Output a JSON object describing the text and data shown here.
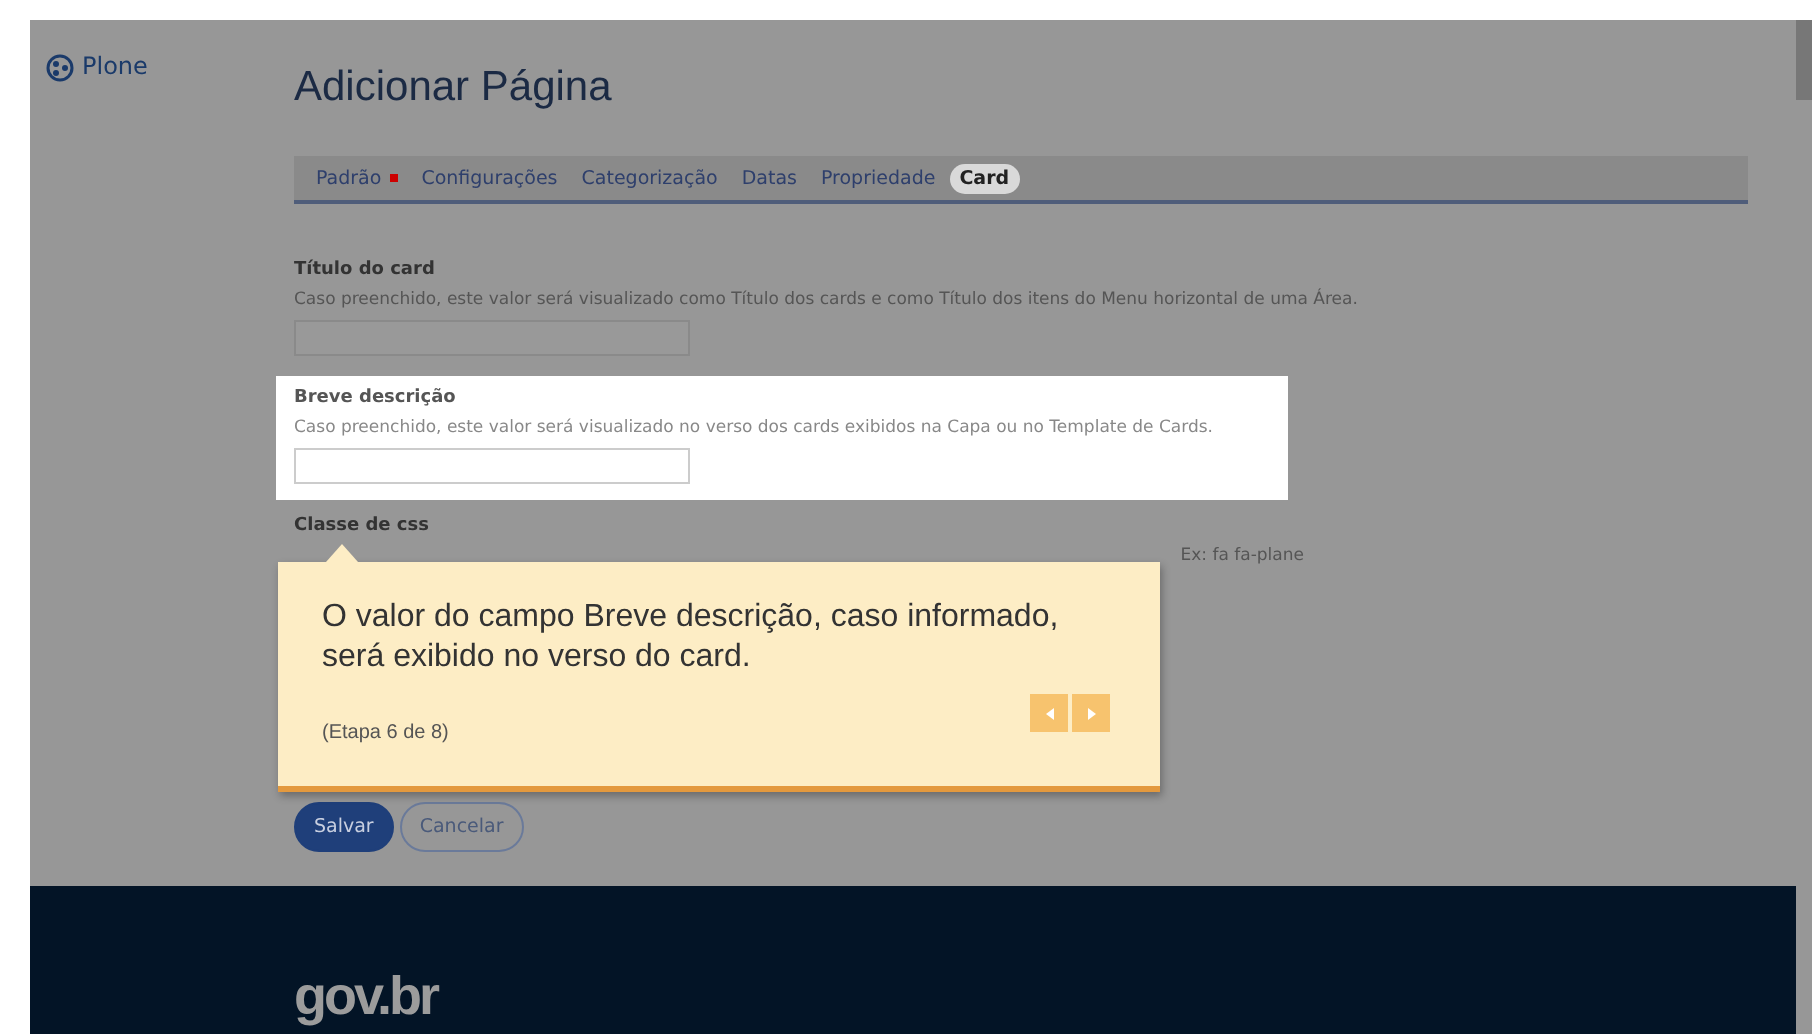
{
  "logo": {
    "text": "Plone"
  },
  "page": {
    "title": "Adicionar Página"
  },
  "tabs": [
    {
      "label": "Padrão",
      "selected": false,
      "required": true
    },
    {
      "label": "Configurações",
      "selected": false,
      "required": false
    },
    {
      "label": "Categorização",
      "selected": false,
      "required": false
    },
    {
      "label": "Datas",
      "selected": false,
      "required": false
    },
    {
      "label": "Propriedade",
      "selected": false,
      "required": false
    },
    {
      "label": "Card",
      "selected": true,
      "required": false
    }
  ],
  "fields": [
    {
      "label": "Título do card",
      "hint": "Caso preenchido, este valor será visualizado como Título dos cards e como Título dos itens do Menu horizontal de uma Área.",
      "highlighted": false
    },
    {
      "label": "Breve descrição",
      "hint": "Caso preenchido, este valor será visualizado no verso dos cards exibidos na Capa ou no Template de Cards.",
      "highlighted": true
    }
  ],
  "css_field": {
    "label": "Classe de css",
    "hint": "Ex: fa fa-plane"
  },
  "tooltip": {
    "message": "O valor do campo Breve descrição, caso informado, será exibido no verso do card.",
    "step": "(Etapa 6 de 8)"
  },
  "buttons": [
    {
      "label": "Salvar",
      "kind": "primary"
    },
    {
      "label": "Cancelar",
      "kind": "secondary"
    }
  ],
  "footer": {
    "logo": "gov.br"
  }
}
